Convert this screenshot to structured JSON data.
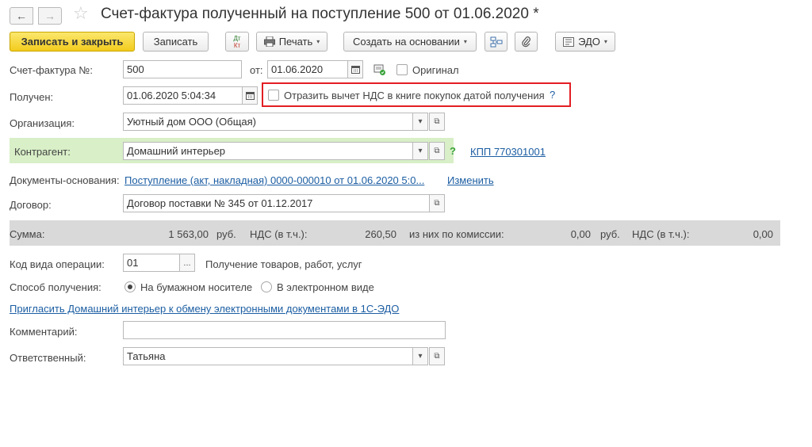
{
  "window": {
    "title": "Счет-фактура полученный на поступление 500 от 01.06.2020 *",
    "back_icon": "←",
    "forward_icon": "→",
    "star_icon": "☆"
  },
  "toolbar": {
    "save_close": "Записать и закрыть",
    "save": "Записать",
    "dtkt_top": "Дт",
    "dtkt_bottom": "Кт",
    "print": "Печать",
    "create_based": "Создать на основании",
    "edo": "ЭДО",
    "caret": "▾"
  },
  "form": {
    "invoice_label": "Счет-фактура №:",
    "invoice_number": "500",
    "from_label": "от:",
    "invoice_date": "01.06.2020",
    "original_label": "Оригинал",
    "received_label": "Получен:",
    "received_datetime": "01.06.2020  5:04:34",
    "vat_deduction_label": "Отразить вычет НДС в книге покупок датой получения",
    "help_mark": "?",
    "org_label": "Организация:",
    "org_value": "Уютный дом ООО (Общая)",
    "counterparty_label": "Контрагент:",
    "counterparty_value": "Домашний интерьер",
    "kpp_link": "КПП 770301001",
    "base_docs_label": "Документы-основания:",
    "base_docs_link": "Поступление (акт, накладная) 0000-000010 от 01.06.2020 5:0...",
    "change_link": "Изменить",
    "contract_label": "Договор:",
    "contract_value": "Договор  поставки № 345 от 01.12.2017",
    "op_code_label": "Код вида операции:",
    "op_code_value": "01",
    "ellipsis": "...",
    "op_code_desc": "Получение товаров, работ, услуг",
    "method_label": "Способ получения:",
    "method_paper": "На бумажном носителе",
    "method_electronic": "В электронном виде",
    "invite_link": "Пригласить Домашний интерьер к обмену электронными документами в 1С-ЭДО",
    "comment_label": "Комментарий:",
    "comment_value": "",
    "responsible_label": "Ответственный:",
    "responsible_value": "Татьяна",
    "dropdown_icon": "▾",
    "open_icon": "⧉",
    "calendar_icon": "▦"
  },
  "sum": {
    "label": "Сумма:",
    "amount": "1 563,00",
    "currency": "руб.",
    "vat_label": "НДС (в т.ч.):",
    "vat_amount": "260,50",
    "commission_label": "из них по комиссии:",
    "commission_amount": "0,00",
    "commission_currency": "руб.",
    "commission_vat_label": "НДС (в т.ч.):",
    "commission_vat_amount": "0,00"
  }
}
